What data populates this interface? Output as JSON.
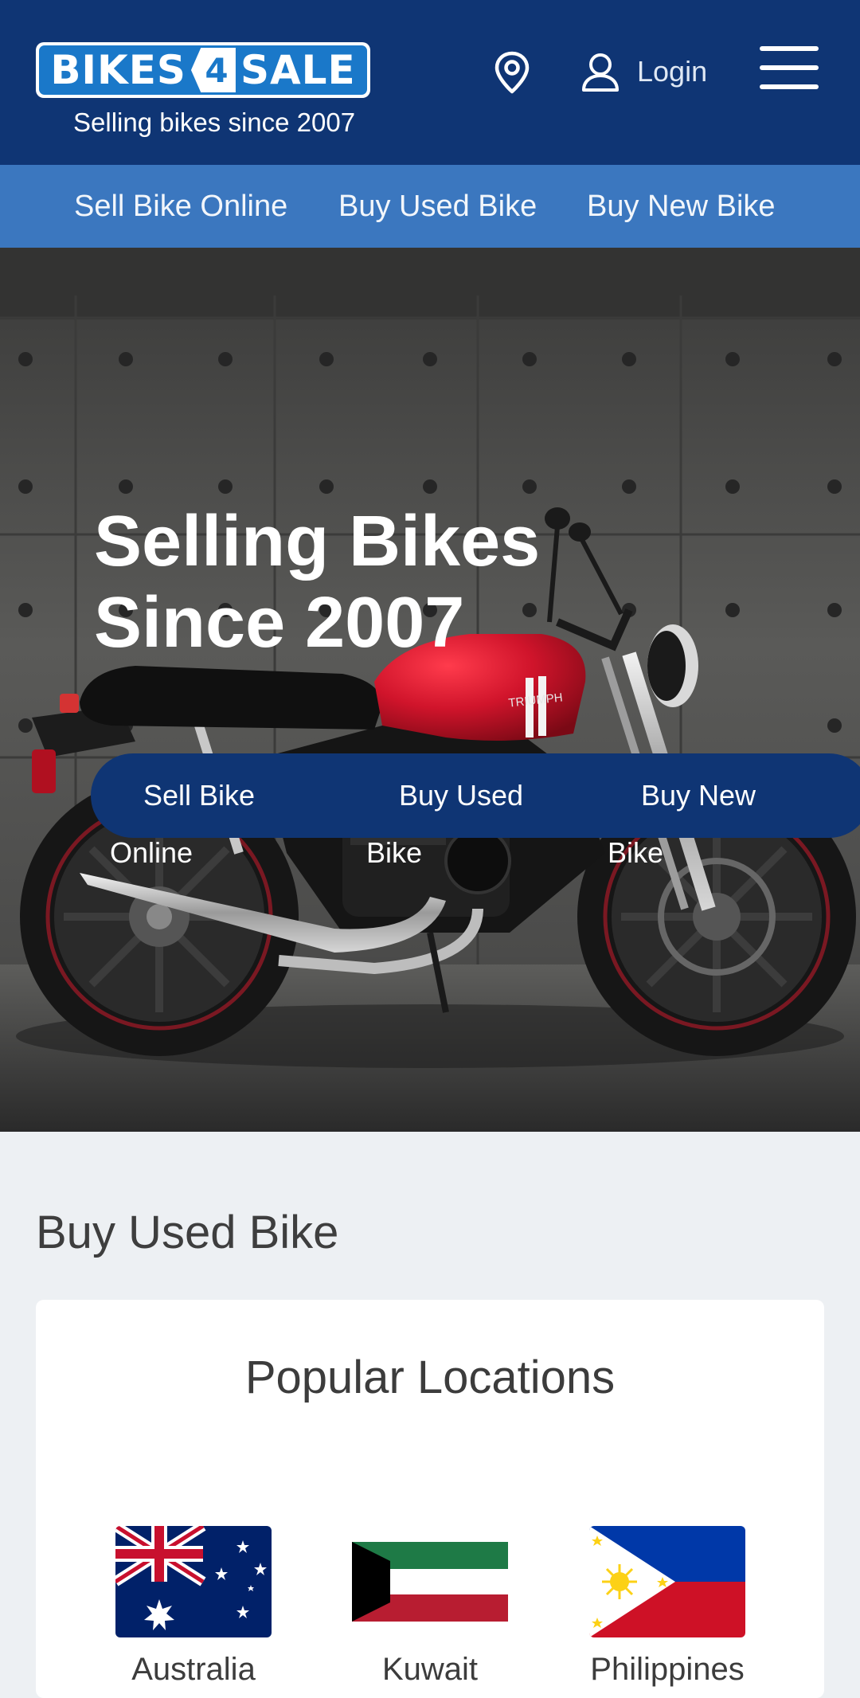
{
  "header": {
    "logo_left": "BIKES",
    "logo_number": "4",
    "logo_right": "SALE",
    "tagline": "Selling bikes since 2007",
    "location_icon": "map-pin-icon",
    "login_icon": "user-icon",
    "login_label": "Login",
    "menu_icon": "hamburger-menu-icon"
  },
  "subnav": {
    "items": [
      {
        "label": "Sell Bike Online"
      },
      {
        "label": "Buy Used Bike"
      },
      {
        "label": "Buy New Bike"
      }
    ]
  },
  "hero": {
    "title_line1": "Selling Bikes",
    "title_line2": "Since 2007",
    "image_subject": "red motorcycle against concrete wall",
    "bike_brand_text": "TRIUMPH",
    "cta": [
      {
        "line1": "Sell Bike",
        "line2": "Online"
      },
      {
        "line1": "Buy Used",
        "line2": "Bike"
      },
      {
        "line1": "Buy New",
        "line2": "Bike"
      }
    ]
  },
  "buy_used": {
    "section_title": "Buy Used Bike",
    "card_title": "Popular Locations",
    "locations": [
      {
        "name": "Australia",
        "flag": "australia-flag"
      },
      {
        "name": "Kuwait",
        "flag": "kuwait-flag"
      },
      {
        "name": "Philippines",
        "flag": "philippines-flag"
      }
    ]
  },
  "colors": {
    "header_bg": "#0f3574",
    "subnav_bg": "#3b77bf",
    "logo_blue": "#1a78c9",
    "page_bg": "#edf0f3",
    "bike_red": "#c8102e"
  }
}
